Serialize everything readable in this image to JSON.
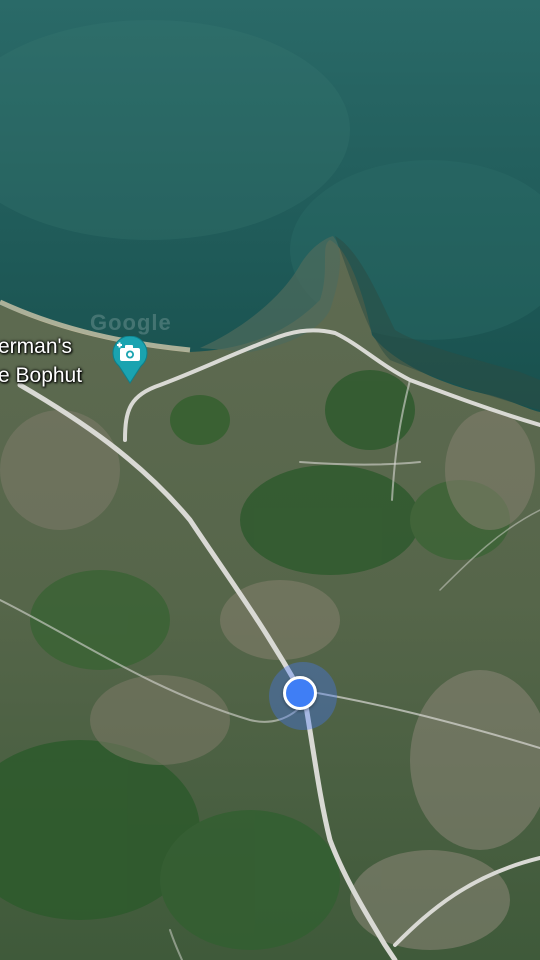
{
  "map": {
    "type": "satellite",
    "place_label": {
      "line1": "erman's",
      "line2": "e Bophut"
    },
    "poi_icon": "camera-icon",
    "watermark": "Google",
    "current_location_icon": "my-location-dot",
    "colors": {
      "sea": "#1f5f5c",
      "road": "#d9d9d4",
      "pin": "#1aa3b0",
      "location": "#3f7ef5"
    }
  }
}
